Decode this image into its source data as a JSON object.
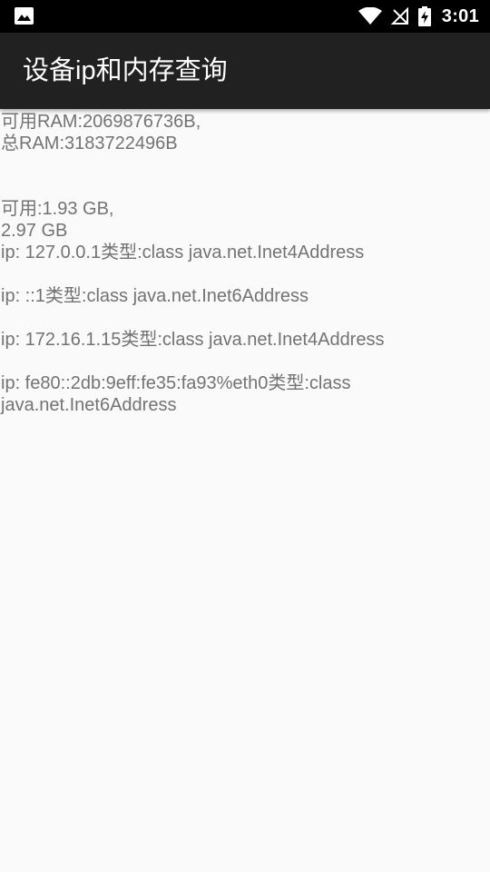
{
  "status_bar": {
    "time": "3:01",
    "icons": {
      "left": "image-notification-icon",
      "wifi": "wifi-icon",
      "signal": "no-signal-icon",
      "battery": "battery-charging-icon"
    }
  },
  "app_bar": {
    "title": "设备ip和内存查询"
  },
  "content": {
    "ram_available": "可用RAM:2069876736B,",
    "ram_total": "总RAM:3183722496B",
    "mem_available": "可用:1.93 GB,",
    "mem_total": "2.97 GB",
    "ip_list": [
      "ip: 127.0.0.1类型:class java.net.Inet4Address",
      "ip: ::1类型:class java.net.Inet6Address",
      "ip: 172.16.1.15类型:class java.net.Inet4Address",
      "ip: fe80::2db:9eff:fe35:fa93%eth0类型:class java.net.Inet6Address"
    ]
  },
  "colors": {
    "status_bar": "#000000",
    "app_bar": "#212121",
    "background": "#fafafa",
    "text": "#737373"
  }
}
